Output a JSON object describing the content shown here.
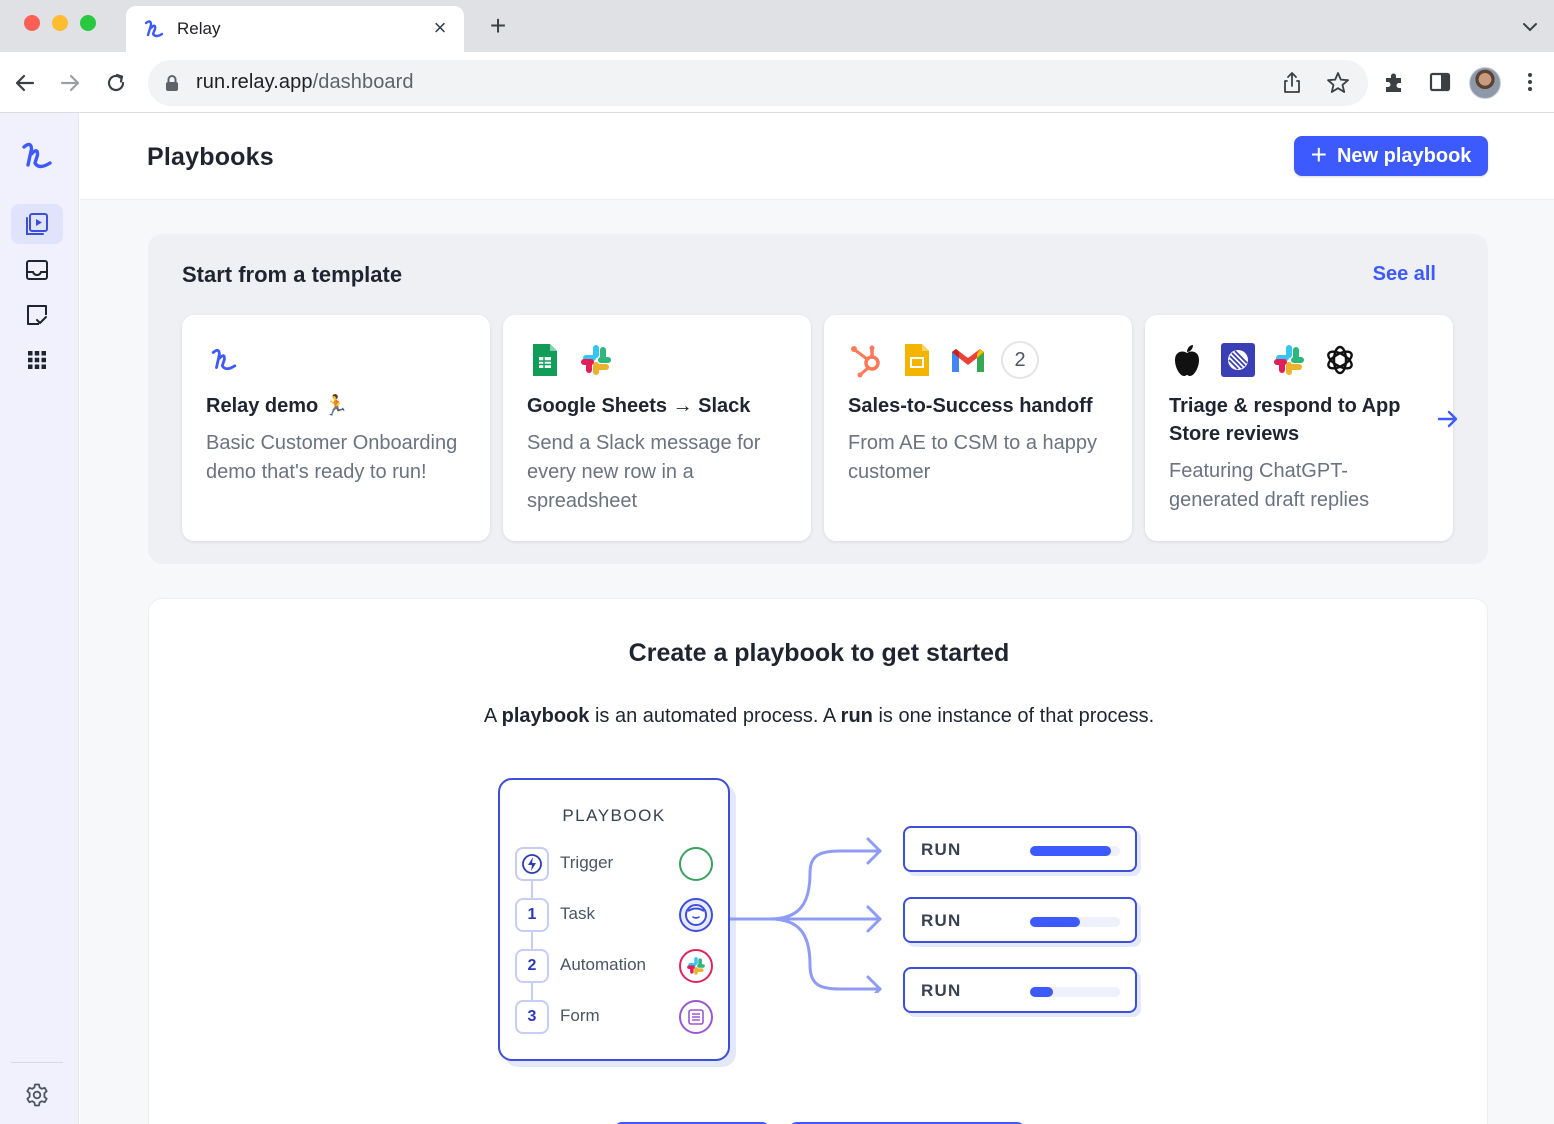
{
  "browser": {
    "tab_title": "Relay",
    "url_host": "run.relay.app",
    "url_path": "/dashboard"
  },
  "sidebar": {
    "items": [
      {
        "name": "playbooks",
        "icon": "play-square-icon",
        "active": true
      },
      {
        "name": "inbox",
        "icon": "inbox-icon",
        "active": false
      },
      {
        "name": "tasks",
        "icon": "task-board-icon",
        "active": false
      },
      {
        "name": "apps",
        "icon": "grid-icon",
        "active": false
      }
    ],
    "settings_icon": "gear-icon"
  },
  "header": {
    "title": "Playbooks",
    "new_button_label": "New playbook"
  },
  "templates": {
    "title": "Start from a template",
    "see_all_label": "See all",
    "cards": [
      {
        "title": "Relay demo 🏃",
        "description": "Basic Customer Onboarding demo that's ready to run!",
        "icons": [
          "relay-logo-icon"
        ]
      },
      {
        "title": "Google Sheets → Slack",
        "description": "Send a Slack message for every new row in a spreadsheet",
        "icons": [
          "google-sheets-icon",
          "slack-icon"
        ]
      },
      {
        "title": "Sales-to-Success handoff",
        "description": "From AE to CSM to a happy customer",
        "icons": [
          "hubspot-icon",
          "google-slides-icon",
          "gmail-icon"
        ],
        "extra_count": "2"
      },
      {
        "title": "Triage & respond to App Store reviews",
        "description": "Featuring ChatGPT-generated draft replies",
        "icons": [
          "apple-icon",
          "linear-icon",
          "slack-icon",
          "openai-icon"
        ]
      }
    ]
  },
  "create": {
    "title": "Create a playbook to get started",
    "subtitle_parts": [
      "A ",
      "playbook",
      " is an automated process. A ",
      "run",
      " is one instance of that process."
    ]
  },
  "diagram": {
    "playbook_heading": "PLAYBOOK",
    "steps": [
      {
        "badge": "⚡",
        "label": "Trigger",
        "ring_color": "#3aa35b"
      },
      {
        "badge": "1",
        "label": "Task",
        "ring_color": "#3d4fd8"
      },
      {
        "badge": "2",
        "label": "Automation",
        "ring_color": "#e0245e"
      },
      {
        "badge": "3",
        "label": "Form",
        "ring_color": "#9b59d0"
      }
    ],
    "runs": [
      {
        "label": "RUN",
        "progress": 0.9
      },
      {
        "label": "RUN",
        "progress": 0.55
      },
      {
        "label": "RUN",
        "progress": 0.25
      }
    ]
  },
  "colors": {
    "accent": "#3d5afe",
    "sidebar_bg": "#f0f1fc",
    "text_primary": "#1f2430",
    "text_muted": "#6b7280"
  }
}
